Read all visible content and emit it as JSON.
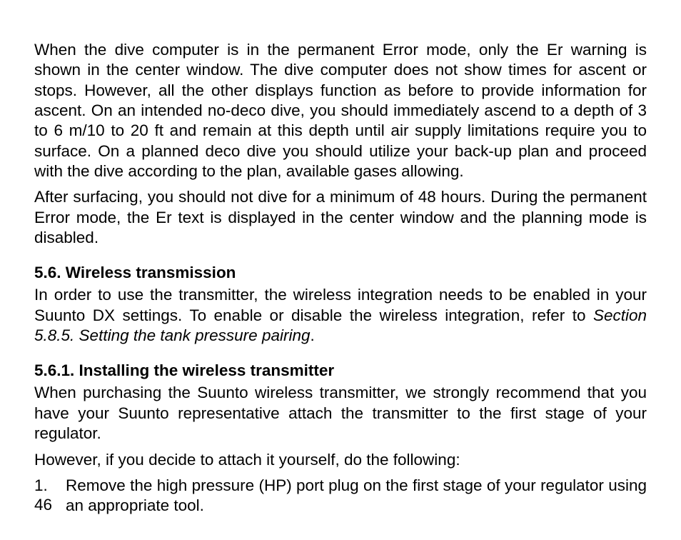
{
  "paragraphs": {
    "p1": "When the dive computer is in the permanent Error mode, only the Er warning is shown in the center window. The dive computer does not show times for ascent or stops. However, all the other displays function as before to provide information for ascent. On an intended no-deco dive, you should immediately ascend to a depth of 3 to 6 m/10 to 20 ft and remain at this depth until air supply limitations require you to surface. On a planned deco dive you should utilize your back-up plan and proceed with the dive according to the plan, available gases allowing.",
    "p2": "After surfacing, you should not dive for a minimum of 48 hours. During the permanent Error mode, the Er text is displayed in the center window and the planning mode is disabled."
  },
  "section_5_6": {
    "heading": "5.6. Wireless transmission",
    "body_prefix": "In order to use the transmitter, the wireless integration needs to be enabled in your Suunto DX settings. To enable or disable the wireless integration, refer to ",
    "body_ref": "Section 5.8.5. Setting the tank pressure pairing",
    "body_suffix": "."
  },
  "section_5_6_1": {
    "heading": "5.6.1. Installing the wireless transmitter",
    "p1": "When purchasing the Suunto wireless transmitter, we strongly recommend that you have your Suunto representative attach the transmitter to the first stage of your regulator.",
    "p2": "However, if you decide to attach it yourself, do the following:",
    "list": [
      {
        "num": "1.",
        "text": "Remove the high pressure (HP) port plug on the first stage of your regulator using an appropriate tool."
      }
    ]
  },
  "page_number": "46"
}
